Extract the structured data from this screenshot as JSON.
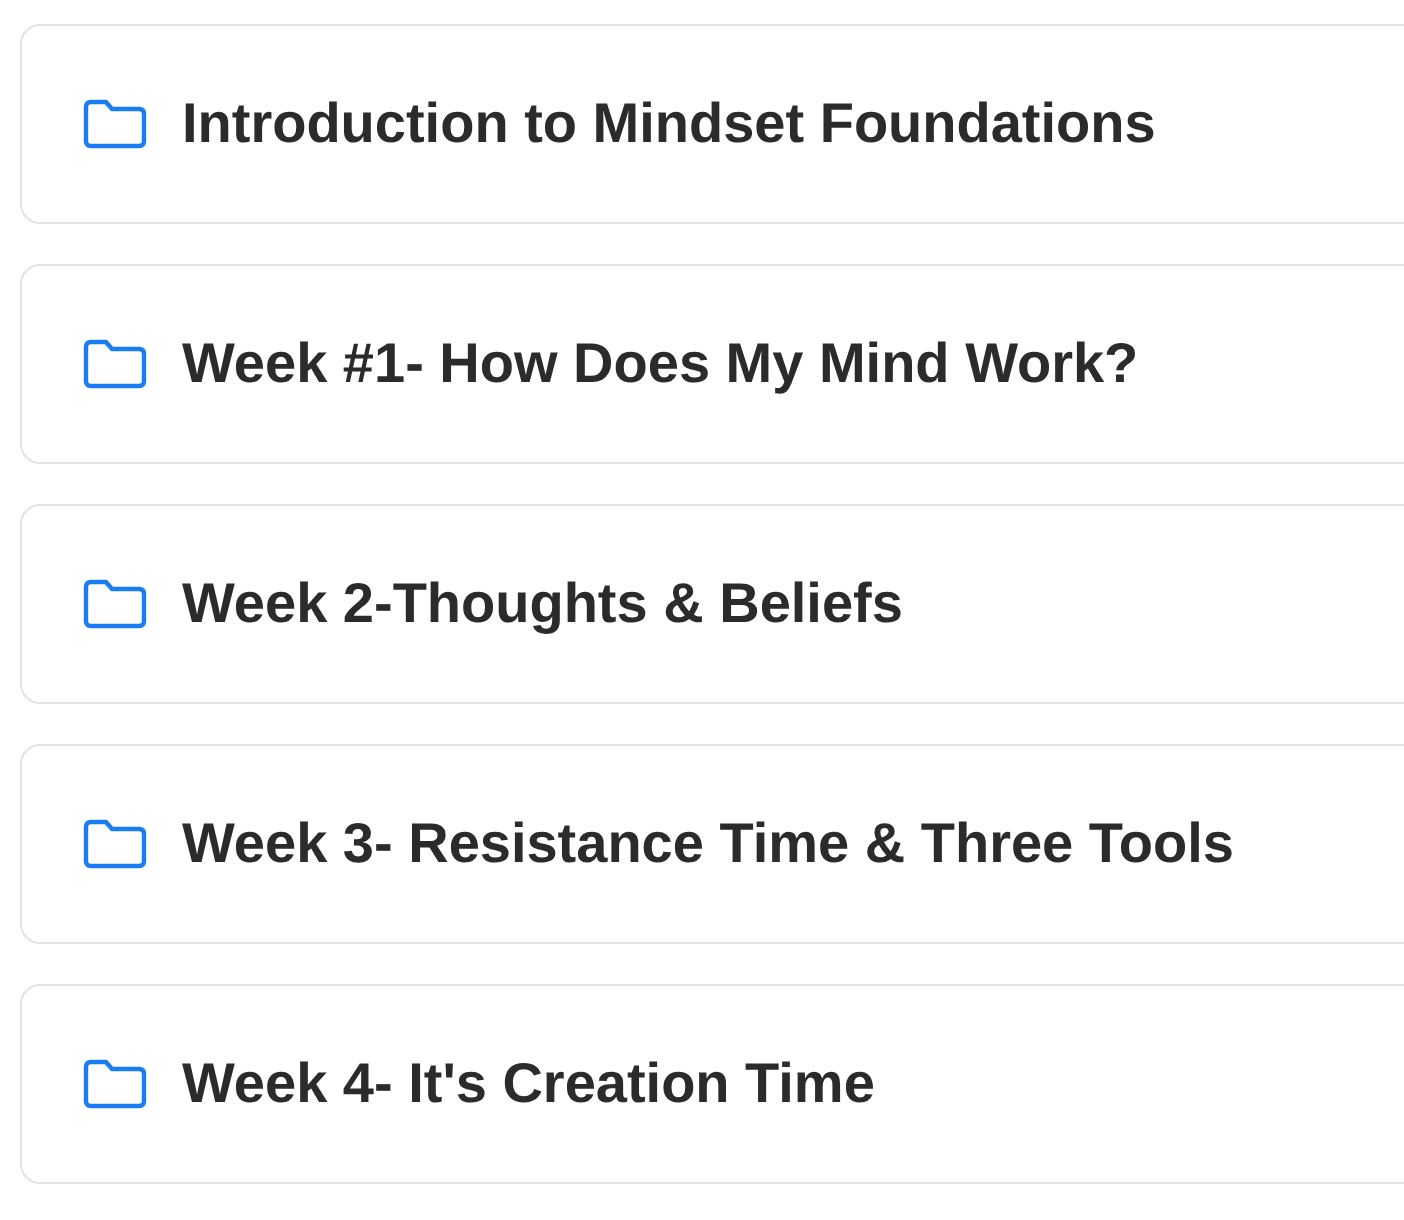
{
  "folders": [
    {
      "title": "Introduction to Mindset Foundations"
    },
    {
      "title": "Week #1- How Does My Mind Work?"
    },
    {
      "title": "Week 2-Thoughts & Beliefs"
    },
    {
      "title": "Week 3- Resistance Time & Three Tools"
    },
    {
      "title": "Week 4- It's Creation Time"
    }
  ]
}
